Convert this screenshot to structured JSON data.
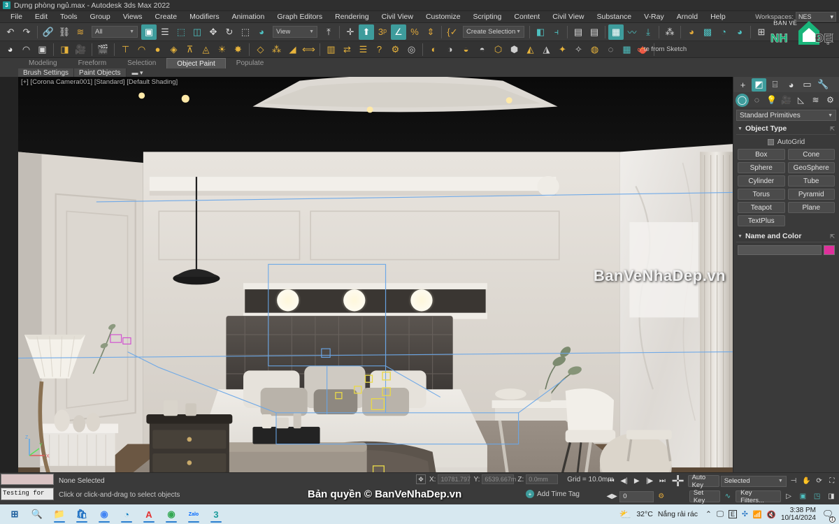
{
  "window": {
    "title": "Dựng phòng ngủ.max - Autodesk 3ds Max 2022",
    "app_icon": "3ds-max-icon"
  },
  "menu": {
    "items": [
      {
        "label": "File"
      },
      {
        "label": "Edit"
      },
      {
        "label": "Tools"
      },
      {
        "label": "Group"
      },
      {
        "label": "Views"
      },
      {
        "label": "Create"
      },
      {
        "label": "Modifiers"
      },
      {
        "label": "Animation"
      },
      {
        "label": "Graph Editors"
      },
      {
        "label": "Rendering"
      },
      {
        "label": "Civil View"
      },
      {
        "label": "Customize"
      },
      {
        "label": "Scripting"
      },
      {
        "label": "Content"
      },
      {
        "label": "Civil View"
      },
      {
        "label": "Substance"
      },
      {
        "label": "V-Ray"
      },
      {
        "label": "Arnold"
      },
      {
        "label": "Help"
      }
    ],
    "workspaces_label": "Workspaces:",
    "workspaces_value": "NES"
  },
  "toolbar": {
    "selection_filter": "All",
    "coord_system": "View",
    "create_selection_set": "Create Selection Se",
    "sketch_text": "te from Sketch",
    "buttons": [
      {
        "name": "undo-button",
        "glyph": "↶"
      },
      {
        "name": "redo-button",
        "glyph": "↷"
      },
      {
        "name": "select-link-button",
        "glyph": "🔗"
      },
      {
        "name": "unlink-button",
        "glyph": "⛓"
      },
      {
        "name": "bind-space-warp-button",
        "glyph": "〰"
      }
    ]
  },
  "ribbon": {
    "tabs": [
      {
        "label": "Modeling",
        "active": false
      },
      {
        "label": "Freeform",
        "active": false
      },
      {
        "label": "Selection",
        "active": false
      },
      {
        "label": "Object Paint",
        "active": true
      },
      {
        "label": "Populate",
        "active": false
      }
    ],
    "subtabs": [
      {
        "label": "Paint Objects"
      },
      {
        "label": "Brush Settings"
      }
    ]
  },
  "viewport": {
    "label": "[+] [Corona Camera001] [Standard] [Default Shading]",
    "watermark": "BanVeNhaDep.vn",
    "scene_description": "Bedroom interior render - bed, nightstands, floor lamp, desk, chair, curtains, ceiling lights"
  },
  "command_panel": {
    "tabs_primary": [
      {
        "name": "create-tab",
        "glyph": "+",
        "selected": false
      },
      {
        "name": "modify-tab",
        "glyph": "◩",
        "selected": true
      },
      {
        "name": "hierarchy-tab",
        "glyph": "⌸",
        "selected": false
      },
      {
        "name": "motion-tab",
        "glyph": "◕",
        "selected": false
      },
      {
        "name": "display-tab",
        "glyph": "▭",
        "selected": false
      },
      {
        "name": "utilities-tab",
        "glyph": "🔧",
        "selected": false
      }
    ],
    "tabs_secondary": [
      {
        "name": "geometry-tab",
        "glyph": "◯",
        "selected": true
      },
      {
        "name": "shapes-tab",
        "glyph": "◌",
        "selected": false
      },
      {
        "name": "lights-tab",
        "glyph": "💡",
        "selected": false
      },
      {
        "name": "cameras-tab",
        "glyph": "🎥",
        "selected": false
      },
      {
        "name": "helpers-tab",
        "glyph": "◺",
        "selected": false
      },
      {
        "name": "space-warps-tab",
        "glyph": "≋",
        "selected": false
      },
      {
        "name": "systems-tab",
        "glyph": "⚙",
        "selected": false
      }
    ],
    "category": "Standard Primitives",
    "object_type": {
      "title": "Object Type",
      "autogrid_label": "AutoGrid",
      "buttons": [
        "Box",
        "Cone",
        "Sphere",
        "GeoSphere",
        "Cylinder",
        "Tube",
        "Torus",
        "Pyramid",
        "Teapot",
        "Plane",
        "TextPlus"
      ]
    },
    "name_and_color": {
      "title": "Name and Color",
      "name_value": "",
      "color": "#e0309c"
    }
  },
  "status_bar": {
    "maxscript_output": "Testing for ",
    "selection_status": "None Selected",
    "prompt": "Click or click-and-drag to select objects",
    "coords": {
      "x_label": "X:",
      "x_value": "10781.797",
      "y_label": "Y:",
      "y_value": "6539.667m",
      "z_label": "Z:",
      "z_value": "0.0mm",
      "grid": "Grid = 10.0mm"
    },
    "add_time_tag": "Add Time Tag",
    "copyright_overlay": "Bản quyền © BanVeNhaDep.vn"
  },
  "animation": {
    "auto_key": "Auto Key",
    "set_key": "Set Key",
    "key_mode": "Selected",
    "key_filters": "Key Filters...",
    "current_frame": "0"
  },
  "taskbar": {
    "apps": [
      {
        "name": "start-button",
        "glyph": "⊞",
        "color": "#1d5f9e",
        "active": false
      },
      {
        "name": "search-button",
        "glyph": "🔍",
        "color": "#333333",
        "active": false
      },
      {
        "name": "file-explorer",
        "glyph": "📁",
        "color": "#f0b323",
        "active": true
      },
      {
        "name": "microsoft-store",
        "glyph": "🛍",
        "color": "#1b6ec2",
        "active": true
      },
      {
        "name": "chrome-browser",
        "glyph": "◉",
        "color": "#4285f4",
        "active": true
      },
      {
        "name": "edge-browser",
        "glyph": "◔",
        "color": "#0e7ec1",
        "active": true
      },
      {
        "name": "autodesk-app",
        "glyph": "A",
        "color": "#e33232",
        "active": true
      },
      {
        "name": "chrome-profile",
        "glyph": "◉",
        "color": "#34a853",
        "active": true
      },
      {
        "name": "zalo-app",
        "glyph": "Zalo",
        "color": "#0068ff",
        "active": true
      },
      {
        "name": "3ds-max-app",
        "glyph": "3",
        "color": "#1a9c9c",
        "active": true
      }
    ],
    "weather_temp": "32°C",
    "weather_desc": "Nắng rải rác",
    "time": "3:38 PM",
    "date": "10/14/2024",
    "tray": [
      {
        "name": "show-hidden-icons",
        "glyph": "⌃"
      },
      {
        "name": "display-icon",
        "glyph": "🖵"
      },
      {
        "name": "eset-icon",
        "glyph": "E"
      },
      {
        "name": "bluetooth-icon",
        "glyph": "✣"
      },
      {
        "name": "network-icon",
        "glyph": "📶"
      },
      {
        "name": "volume-icon",
        "glyph": "🔇"
      }
    ],
    "notification_count": "1"
  },
  "logo": {
    "line1": "BẢN VẼ",
    "line2_a": "NH",
    "line2_b": "ĐẸP",
    "accent": "#19b57a"
  }
}
